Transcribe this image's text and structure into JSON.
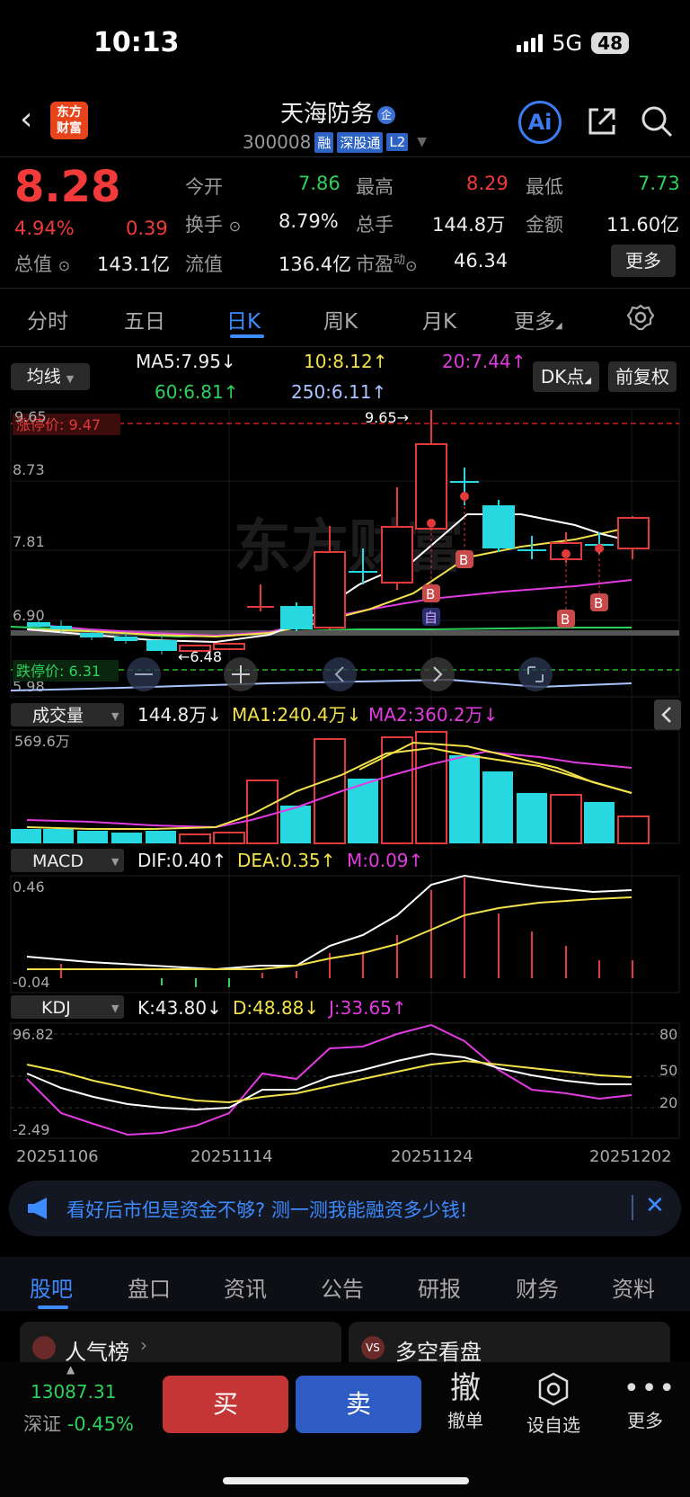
{
  "status_bar": {
    "time": "10:13",
    "network": "5G",
    "battery": "48"
  },
  "header": {
    "logo_line1": "东方",
    "logo_line2": "财富",
    "stock_name": "天海防务",
    "name_badge": "企",
    "stock_code": "300008",
    "tags": [
      "融",
      "深股通",
      "L2"
    ],
    "ai_label": "Ai"
  },
  "quote": {
    "price": "8.28",
    "change_pct": "4.94%",
    "change": "0.39",
    "open_label": "今开",
    "open": "7.86",
    "high_label": "最高",
    "high": "8.29",
    "low_label": "最低",
    "low": "7.73",
    "turnover_label": "换手",
    "turnover": "8.79%",
    "volume_label": "总手",
    "volume": "144.8万",
    "amount_label": "金额",
    "amount": "11.60亿",
    "mktcap_label": "总值",
    "mktcap": "143.1亿",
    "float_label": "流值",
    "float": "136.4亿",
    "pe_label": "市盈",
    "pe_sup": "动",
    "pe": "46.34",
    "more_label": "更多"
  },
  "tabs": [
    "分时",
    "五日",
    "日K",
    "周K",
    "月K",
    "更多"
  ],
  "active_tab": "日K",
  "ma_legend": {
    "selector": "均线",
    "ma5": "MA5:7.95↓",
    "ma10": "10:8.12↑",
    "ma20": "20:7.44↑",
    "ma60": "60:6.81↑",
    "ma250": "250:6.11↑",
    "dk_button": "DK点",
    "adjust_button": "前复权"
  },
  "kline": {
    "y_top": "9.65",
    "limit_up_label": "涨停价: 9.47",
    "y_8_73": "8.73",
    "y_7_81": "7.81",
    "y_6_90": "6.90",
    "y_bottom": "5.98",
    "limit_down_label": "跌停价: 6.31",
    "high_annot": "9.65→",
    "low_annot": "←6.48",
    "signal_b": "B",
    "signal_self": "自",
    "watermark": "东方财富"
  },
  "volume": {
    "selector": "成交量",
    "vol": "144.8万↓",
    "ma1": "MA1:240.4万↓",
    "ma2": "MA2:360.2万↓",
    "y_top": "569.6万"
  },
  "macd": {
    "selector": "MACD",
    "dif": "DIF:0.40↑",
    "dea": "DEA:0.35↑",
    "m": "M:0.09↑",
    "y_top": "0.46",
    "y_bottom": "-0.04"
  },
  "kdj": {
    "selector": "KDJ",
    "k": "K:43.80↓",
    "d": "D:48.88↓",
    "j": "J:33.65↑",
    "y_top": "96.82",
    "y_bottom": "-2.49",
    "r80": "80",
    "r50": "50",
    "r20": "20"
  },
  "dates": [
    "20251106",
    "20251114",
    "20251124",
    "20251202"
  ],
  "banner": {
    "text": "看好后市但是资金不够? 测一测我能融资多少钱!"
  },
  "bottom_tabs": [
    "股吧",
    "盘口",
    "资讯",
    "公告",
    "研报",
    "财务",
    "资料"
  ],
  "cards": {
    "left": "人气榜",
    "right": "多空看盘",
    "right_badge": "VS"
  },
  "footer": {
    "index_value": "13087.31",
    "index_name": "深证",
    "index_change": "-0.45%",
    "buy": "买",
    "sell": "卖",
    "cancel_big": "撤",
    "cancel": "撤单",
    "watch": "设自选",
    "more": "更多"
  },
  "colors": {
    "up": "#f23a3a",
    "down": "#2ed15c",
    "accent": "#3d8bff",
    "ma5": "#ffffff",
    "ma10": "#f2e14a",
    "ma20": "#e23be0",
    "ma60": "#2ed15c",
    "ma250": "#a9c4ff",
    "candle_down": "#27d8e0"
  }
}
